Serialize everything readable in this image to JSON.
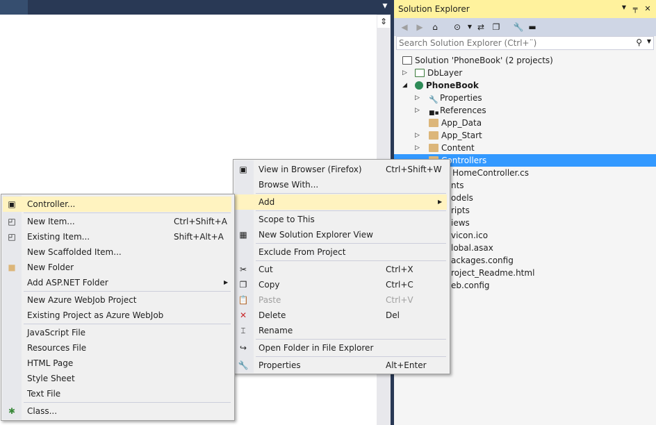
{
  "solution_explorer": {
    "title": "Solution Explorer",
    "search_placeholder": "Search Solution Explorer (Ctrl+¨)",
    "tree": [
      {
        "label": "Solution 'PhoneBook' (2 projects)"
      },
      {
        "label": "DbLayer"
      },
      {
        "label": "PhoneBook"
      },
      {
        "label": "Properties"
      },
      {
        "label": "References"
      },
      {
        "label": "App_Data"
      },
      {
        "label": "App_Start"
      },
      {
        "label": "Content"
      },
      {
        "label": "Controllers"
      },
      {
        "label": "HomeController.cs"
      },
      {
        "label": "nts"
      },
      {
        "label": "odels"
      },
      {
        "label": "ripts"
      },
      {
        "label": "iews"
      },
      {
        "label": "vicon.ico"
      },
      {
        "label": "lobal.asax"
      },
      {
        "label": "ackages.config"
      },
      {
        "label": "roject_Readme.html"
      },
      {
        "label": "eb.config"
      }
    ]
  },
  "context_menu": {
    "items": [
      {
        "label": "View in Browser (Firefox)",
        "shortcut": "Ctrl+Shift+W"
      },
      {
        "label": "Browse With...",
        "shortcut": ""
      },
      {
        "label": "Add",
        "shortcut": ""
      },
      {
        "label": "Scope to This",
        "shortcut": ""
      },
      {
        "label": "New Solution Explorer View",
        "shortcut": ""
      },
      {
        "label": "Exclude From Project",
        "shortcut": ""
      },
      {
        "label": "Cut",
        "shortcut": "Ctrl+X"
      },
      {
        "label": "Copy",
        "shortcut": "Ctrl+C"
      },
      {
        "label": "Paste",
        "shortcut": "Ctrl+V"
      },
      {
        "label": "Delete",
        "shortcut": "Del"
      },
      {
        "label": "Rename",
        "shortcut": ""
      },
      {
        "label": "Open Folder in File Explorer",
        "shortcut": ""
      },
      {
        "label": "Properties",
        "shortcut": "Alt+Enter"
      }
    ]
  },
  "add_submenu": {
    "items": [
      {
        "label": "Controller...",
        "shortcut": ""
      },
      {
        "label": "New Item...",
        "shortcut": "Ctrl+Shift+A"
      },
      {
        "label": "Existing Item...",
        "shortcut": "Shift+Alt+A"
      },
      {
        "label": "New Scaffolded Item...",
        "shortcut": ""
      },
      {
        "label": "New Folder",
        "shortcut": ""
      },
      {
        "label": "Add ASP.NET Folder",
        "shortcut": ""
      },
      {
        "label": "New Azure WebJob Project",
        "shortcut": ""
      },
      {
        "label": "Existing Project as Azure WebJob",
        "shortcut": ""
      },
      {
        "label": "JavaScript File",
        "shortcut": ""
      },
      {
        "label": "Resources File",
        "shortcut": ""
      },
      {
        "label": "HTML Page",
        "shortcut": ""
      },
      {
        "label": "Style Sheet",
        "shortcut": ""
      },
      {
        "label": "Text File",
        "shortcut": ""
      },
      {
        "label": "Class...",
        "shortcut": ""
      }
    ]
  },
  "colors": {
    "frame": "#293955",
    "title_active": "#fff29d",
    "selection": "#3399ff",
    "menu_highlight": "#fff3c0",
    "folder": "#dcb67a"
  }
}
